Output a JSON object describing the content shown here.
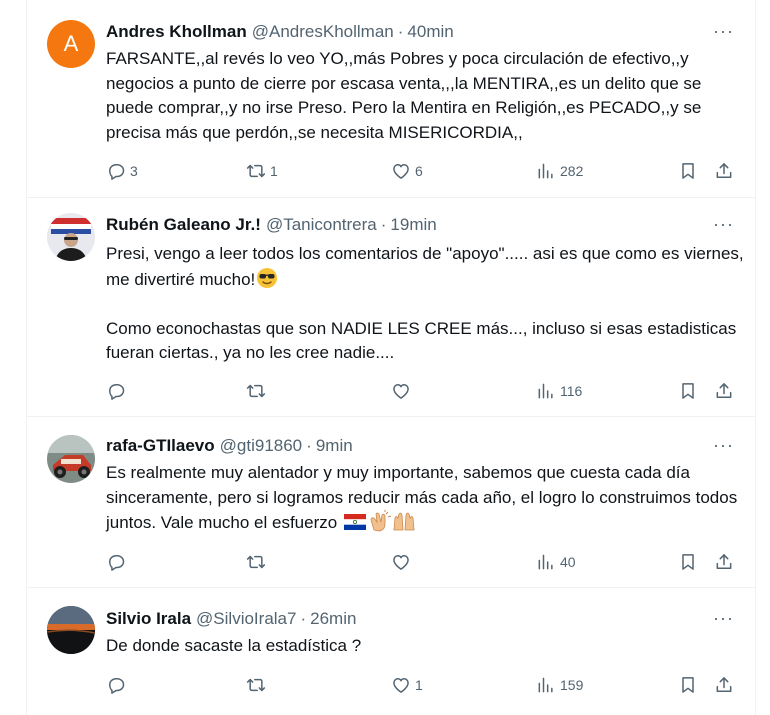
{
  "tweets": [
    {
      "avatar_letter": "A",
      "name": "Andres Khollman",
      "handle": "@AndresKhollman",
      "time": "40min",
      "text": [
        "FARSANTE,,al revés lo veo YO,,más Pobres y poca circulación de efectivo,,y negocios a punto de cierre por escasa venta,,,la MENTIRA,,es un delito que se puede comprar,,y no irse Preso. Pero la Mentira en Religión,,es PECADO,,y se precisa más que perdón,,se necesita MISERICORDIA,,"
      ],
      "replies": "3",
      "retweets": "1",
      "likes": "6",
      "views": "282"
    },
    {
      "name": "Rubén Galeano Jr.!",
      "handle": "@Tanicontrera",
      "time": "19min",
      "text": [
        "Presi, vengo a leer todos los comentarios de \"apoyo\"..... asi es que como es viernes, me divertiré mucho!",
        "Como econochastas que son NADIE LES CREE más..., incluso si esas estadisticas fueran ciertas., ya no les cree nadie...."
      ],
      "emoji": "😎",
      "replies": "",
      "retweets": "",
      "likes": "",
      "views": "116"
    },
    {
      "name": "rafa-GTIlaevo",
      "handle": "@gti91860",
      "time": "9min",
      "text": [
        "Es realmente muy alentador y muy importante, sabemos que cuesta cada día sinceramente, pero si logramos reducir más cada año, el logro lo construimos todos juntos. Vale mucho el esfuerzo"
      ],
      "emojis": [
        "🇵🇾",
        "👏",
        "🙌"
      ],
      "replies": "",
      "retweets": "",
      "likes": "",
      "views": "40"
    },
    {
      "name": "Silvio Irala",
      "handle": "@SilvioIrala7",
      "time": "26min",
      "text": [
        "De donde sacaste la estadística ?"
      ],
      "replies": "",
      "retweets": "",
      "likes": "1",
      "views": "159"
    }
  ],
  "ui": {
    "dot": "·",
    "more": "···"
  },
  "colors": {
    "avatar_a": "#f4780f",
    "muted": "#536471",
    "text": "#0f1419",
    "border": "#eff3f4"
  },
  "icons": [
    "reply-icon",
    "retweet-icon",
    "like-icon",
    "views-icon",
    "bookmark-icon",
    "share-icon",
    "more-icon"
  ]
}
